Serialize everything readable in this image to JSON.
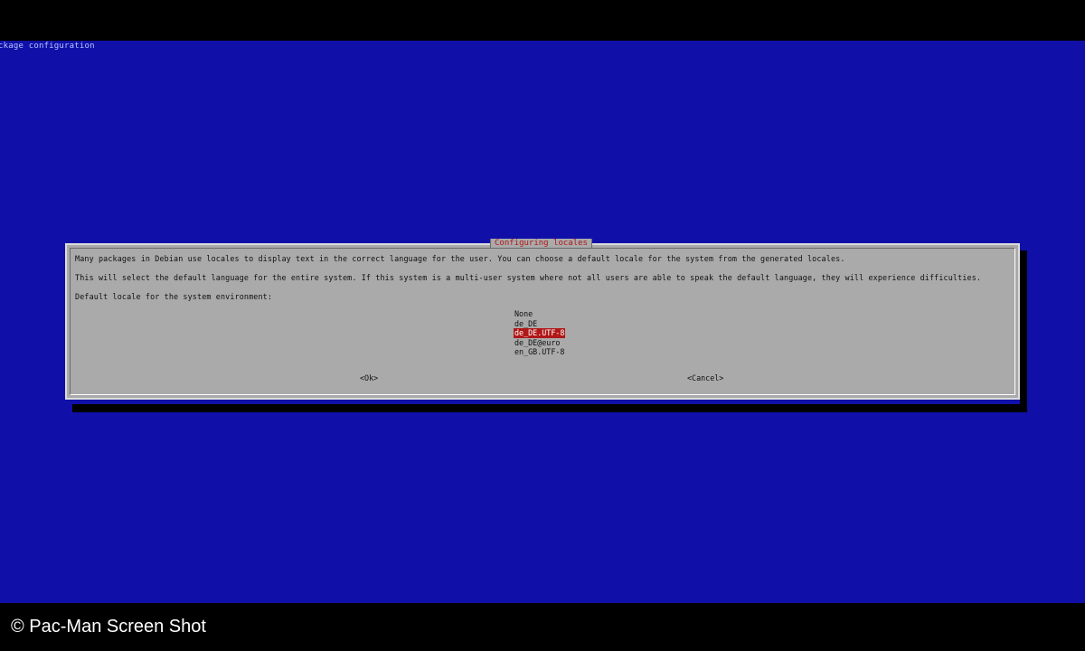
{
  "backtitle": "ckage configuration",
  "dialog": {
    "title": "Configuring locales",
    "paragraph1": "Many packages in Debian use locales to display text in the correct language for the user. You can choose a default locale for the system from the generated locales.",
    "paragraph2": "This will select the default language for the entire system. If this system is a multi-user system where not all users are able to speak the default language, they will experience difficulties.",
    "prompt": "Default locale for the system environment:",
    "locales": [
      {
        "label": "None",
        "selected": false
      },
      {
        "label": "de_DE",
        "selected": false
      },
      {
        "label": "de_DE.UTF-8",
        "selected": true
      },
      {
        "label": "de_DE@euro",
        "selected": false
      },
      {
        "label": "en_GB.UTF-8",
        "selected": false
      }
    ],
    "ok_label": "<Ok>",
    "cancel_label": "<Cancel>"
  },
  "caption": "© Pac-Man Screen Shot",
  "colors": {
    "background": "#1010a8",
    "dialog": "#aaaaaa",
    "accent": "#b01818"
  }
}
